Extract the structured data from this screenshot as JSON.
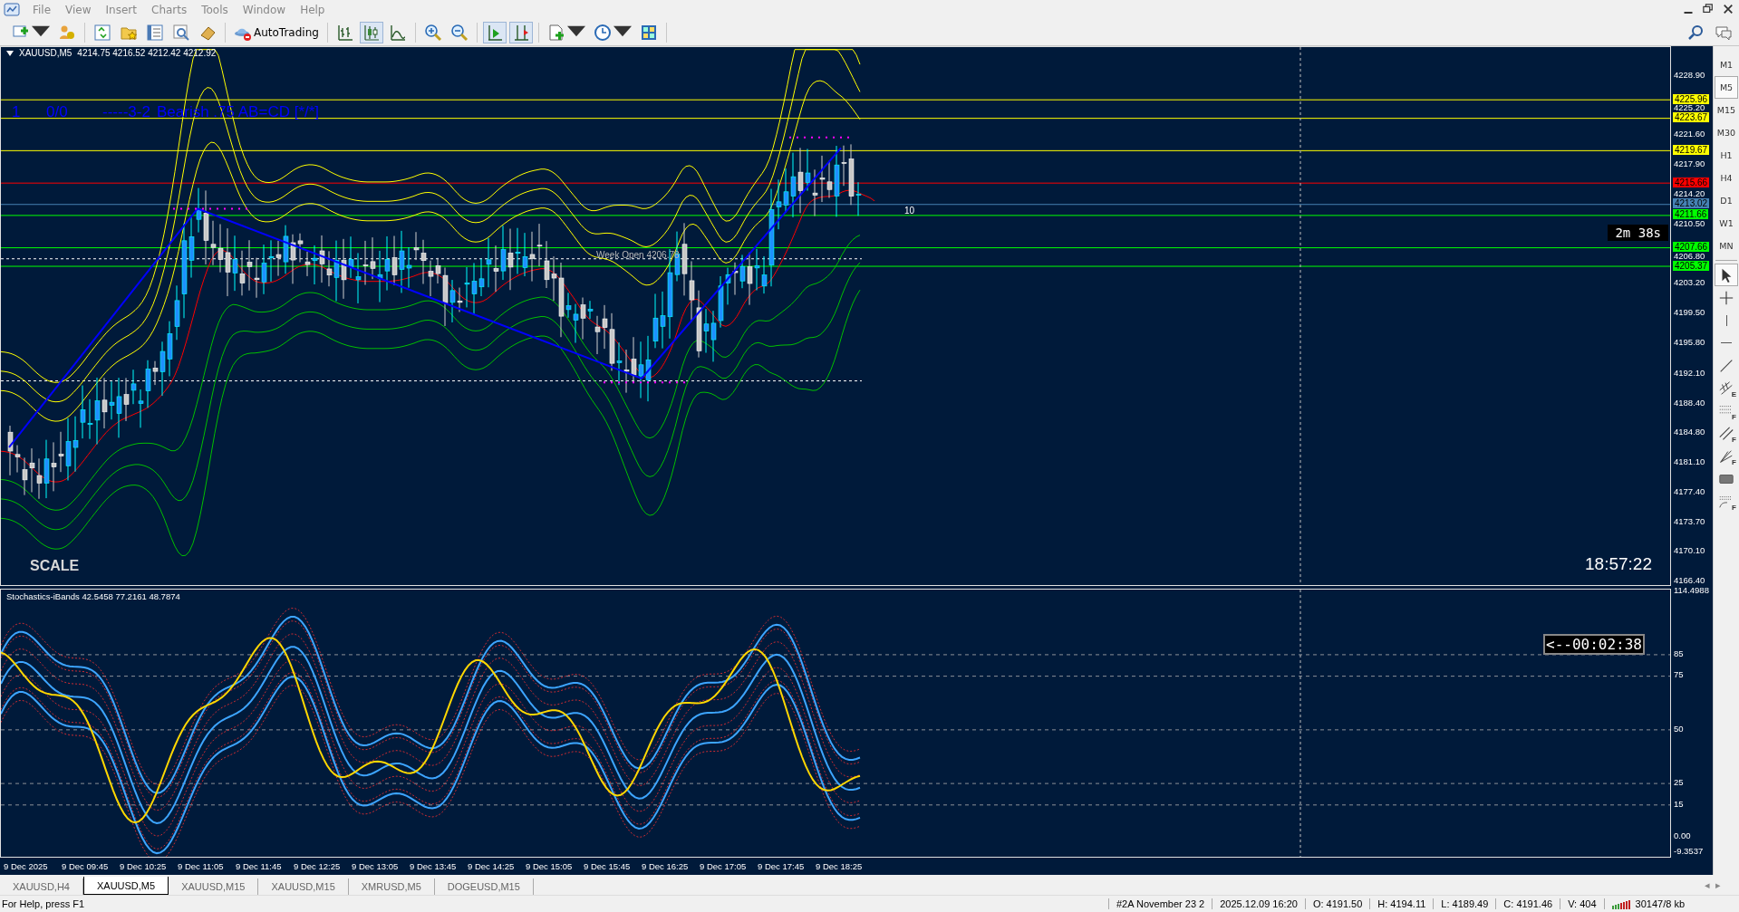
{
  "menu": {
    "items": [
      "File",
      "View",
      "Insert",
      "Charts",
      "Tools",
      "Window",
      "Help"
    ],
    "window_controls": [
      {
        "kind": "minimize"
      },
      {
        "kind": "restore"
      },
      {
        "kind": "close"
      }
    ]
  },
  "toolbar": {
    "groups": [
      [
        {
          "kind": "new-chart",
          "dropdown": true,
          "pressed": false
        },
        {
          "kind": "profiles",
          "dropdown": false,
          "pressed": false
        }
      ],
      [
        {
          "kind": "market-watch",
          "dropdown": false,
          "pressed": false
        },
        {
          "kind": "navigator",
          "dropdown": false,
          "pressed": false
        },
        {
          "kind": "terminal",
          "dropdown": false,
          "pressed": false
        },
        {
          "kind": "tester",
          "dropdown": false,
          "pressed": false
        },
        {
          "kind": "eraser",
          "dropdown": false,
          "pressed": false
        }
      ],
      [
        {
          "kind": "autotrading",
          "label": "AutoTrading",
          "dropdown": false,
          "pressed": false
        }
      ],
      [
        {
          "kind": "bar-chart",
          "dropdown": false,
          "pressed": false
        },
        {
          "kind": "candles",
          "dropdown": false,
          "pressed": true
        },
        {
          "kind": "line-chart",
          "dropdown": false,
          "pressed": false
        }
      ],
      [
        {
          "kind": "zoom-in",
          "dropdown": false,
          "pressed": false
        },
        {
          "kind": "zoom-out",
          "dropdown": false,
          "pressed": false
        }
      ],
      [
        {
          "kind": "autoscroll",
          "dropdown": false,
          "pressed": true
        },
        {
          "kind": "chart-shift",
          "dropdown": false,
          "pressed": true
        }
      ],
      [
        {
          "kind": "indicators",
          "dropdown": true,
          "pressed": false
        },
        {
          "kind": "periods",
          "dropdown": true,
          "pressed": false
        },
        {
          "kind": "templates",
          "dropdown": false,
          "pressed": false
        }
      ]
    ],
    "right_icons": [
      {
        "kind": "search"
      },
      {
        "kind": "chat"
      }
    ]
  },
  "chart": {
    "symbol": "XAUUSD,M5",
    "ohlc": "4214.75 4216.52 4212.42 4212.92",
    "pattern_labels": [
      "1",
      "0/0",
      "-----3-2",
      "Bearish .75 AB=CD [*/*]"
    ],
    "week_open": "Week Open 4206.78",
    "bar_label": "10",
    "countdown": "2m 38s",
    "clock": "18:57:22",
    "scale_label": "SCALE",
    "price_ticks": [
      "4228.90",
      "4225.20",
      "4221.60",
      "4217.90",
      "4214.20",
      "4210.50",
      "4206.80",
      "4203.20",
      "4199.50",
      "4195.80",
      "4192.10",
      "4188.40",
      "4184.80",
      "4181.10",
      "4177.40",
      "4173.70",
      "4170.10",
      "4166.40"
    ],
    "levels": [
      {
        "price": "4225.96",
        "color": "#ffff00"
      },
      {
        "price": "4223.67",
        "color": "#ffff00"
      },
      {
        "price": "4219.67",
        "color": "#ffff00"
      },
      {
        "price": "4215.66",
        "color": "#ff0000"
      },
      {
        "price": "4213.02",
        "color": "#4682b4"
      },
      {
        "price": "4211.66",
        "color": "#00ff00"
      },
      {
        "price": "4207.66",
        "color": "#00ff00"
      },
      {
        "price": "4205.37",
        "color": "#00ff00"
      }
    ]
  },
  "indicator": {
    "label": "Stochastics-iBands 42.5458 77.2161 48.7874",
    "timer": "<--00:02:38",
    "ticks": [
      "114.4988",
      "85",
      "75",
      "50",
      "25",
      "15",
      "0.00",
      "-9.3537"
    ]
  },
  "time_axis": [
    "9 Dec 2025",
    "9 Dec 09:45",
    "9 Dec 10:25",
    "9 Dec 11:05",
    "9 Dec 11:45",
    "9 Dec 12:25",
    "9 Dec 13:05",
    "9 Dec 13:45",
    "9 Dec 14:25",
    "9 Dec 15:05",
    "9 Dec 15:45",
    "9 Dec 16:25",
    "9 Dec 17:05",
    "9 Dec 17:45",
    "9 Dec 18:25"
  ],
  "tabs": [
    {
      "label": "XAUUSD,H4",
      "selected": false
    },
    {
      "label": "XAUUSD,M5",
      "selected": true
    },
    {
      "label": "XAUUSD,M15",
      "selected": false
    },
    {
      "label": "XAUUSD,M15",
      "selected": false
    },
    {
      "label": "XMRUSD,M5",
      "selected": false
    },
    {
      "label": "DOGEUSD,M15",
      "selected": false
    }
  ],
  "tab_scroll": [
    "◂",
    "▸"
  ],
  "timeframes": [
    {
      "label": "M1",
      "selected": false
    },
    {
      "label": "M5",
      "selected": true
    },
    {
      "label": "M15",
      "selected": false
    },
    {
      "label": "M30",
      "selected": false
    },
    {
      "label": "H1",
      "selected": false
    },
    {
      "label": "H4",
      "selected": false
    },
    {
      "label": "D1",
      "selected": false
    },
    {
      "label": "W1",
      "selected": false
    },
    {
      "label": "MN",
      "selected": false
    }
  ],
  "tools": [
    {
      "kind": "cursor",
      "selected": true
    },
    {
      "kind": "crosshair",
      "selected": false
    },
    {
      "kind": "vertical-line",
      "selected": false
    },
    {
      "kind": "horizontal-line",
      "selected": false
    },
    {
      "kind": "trendline",
      "selected": false
    },
    {
      "kind": "channel",
      "letter": "E",
      "selected": false
    },
    {
      "kind": "fibo-levels",
      "letter": "F",
      "selected": false
    },
    {
      "kind": "parallel",
      "letter": "F",
      "selected": false
    },
    {
      "kind": "fan",
      "letter": "F",
      "selected": false
    },
    {
      "kind": "rectangle",
      "selected": false
    },
    {
      "kind": "fibo-arc",
      "letter": "F",
      "selected": false
    }
  ],
  "status_bar": {
    "help": "For Help, press F1",
    "fields": [
      "#2A November 23 2",
      "2025.12.09 16:20",
      "O: 4191.50",
      "H: 4194.11",
      "L: 4189.49",
      "C: 4191.46",
      "V: 404"
    ],
    "traffic": "30147/8 kb"
  }
}
